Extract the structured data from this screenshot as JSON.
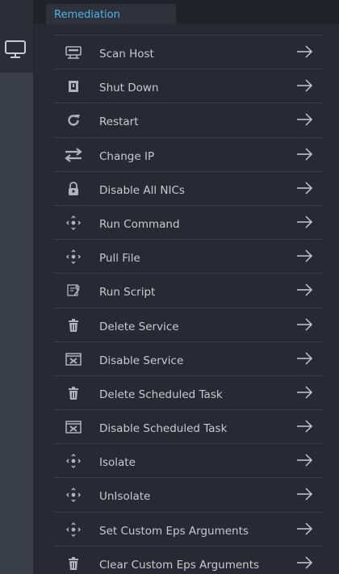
{
  "tabs": [
    {
      "label": "Remediation",
      "active": true
    }
  ],
  "left_rail": {
    "icon": "monitor-icon"
  },
  "actions": [
    {
      "label": "Scan Host",
      "icon": "scan-host-icon"
    },
    {
      "label": "Shut Down",
      "icon": "shutdown-icon"
    },
    {
      "label": "Restart",
      "icon": "restart-icon"
    },
    {
      "label": "Change IP",
      "icon": "change-ip-icon"
    },
    {
      "label": "Disable All NICs",
      "icon": "lock-icon"
    },
    {
      "label": "Run Command",
      "icon": "command-icon"
    },
    {
      "label": "Pull File",
      "icon": "pull-file-icon"
    },
    {
      "label": "Run Script",
      "icon": "script-icon"
    },
    {
      "label": "Delete Service",
      "icon": "trash-icon"
    },
    {
      "label": "Disable Service",
      "icon": "disable-box-icon"
    },
    {
      "label": "Delete Scheduled Task",
      "icon": "trash-icon"
    },
    {
      "label": "Disable Scheduled Task",
      "icon": "disable-box-icon"
    },
    {
      "label": "Isolate",
      "icon": "isolate-icon"
    },
    {
      "label": "UnIsolate",
      "icon": "unisolate-icon"
    },
    {
      "label": "Set Custom Eps Arguments",
      "icon": "set-arguments-icon"
    },
    {
      "label": "Clear Custom Eps Arguments",
      "icon": "trash-icon"
    }
  ],
  "colors": {
    "accent": "#4fb3e8",
    "text": "#c7cad1",
    "icon": "#aeb3bd",
    "background": "#262a34"
  }
}
